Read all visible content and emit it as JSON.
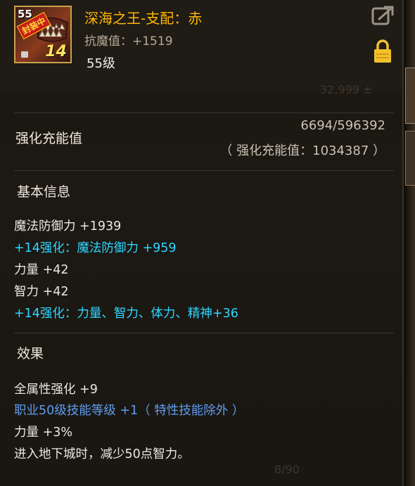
{
  "item": {
    "name": "深海之王-支配：赤",
    "resist": "抗魔值：+1519",
    "level": "55级",
    "icon_badge_level": "55",
    "icon_stamp": "封装中",
    "icon_plus": "14"
  },
  "enhance": {
    "label": "强化充能值",
    "progress": "6694/596392",
    "total": "（ 强化充能值：1034387 ）"
  },
  "basic_info": {
    "heading": "基本信息",
    "stats": [
      {
        "text": "魔法防御力 +1939",
        "color": "white"
      },
      {
        "text": "+14强化：魔法防御力 +959",
        "color": "cyan"
      },
      {
        "text": "力量 +42",
        "color": "white"
      },
      {
        "text": "智力 +42",
        "color": "white"
      },
      {
        "text": "+14强化：力量、智力、体力、精神+36",
        "color": "cyan"
      }
    ]
  },
  "effects": {
    "heading": "效果",
    "lines": [
      {
        "text": "全属性强化 +9",
        "color": "white"
      },
      {
        "text": "职业50级技能等级 +1（ 特性技能除外 ）",
        "color": "blue"
      },
      {
        "text": "力量 +3%",
        "color": "white"
      },
      {
        "text": "进入地下城时，减少50点智力。",
        "color": "white"
      }
    ]
  },
  "ghost": {
    "count": "8/90"
  },
  "colors": {
    "title": "#ffb700",
    "cyan": "#2fd6ff",
    "blue": "#5f9cf0",
    "frame": "#c9a24a"
  },
  "icons": {
    "share": "share-export-icon",
    "lock": "padlock-icon"
  }
}
